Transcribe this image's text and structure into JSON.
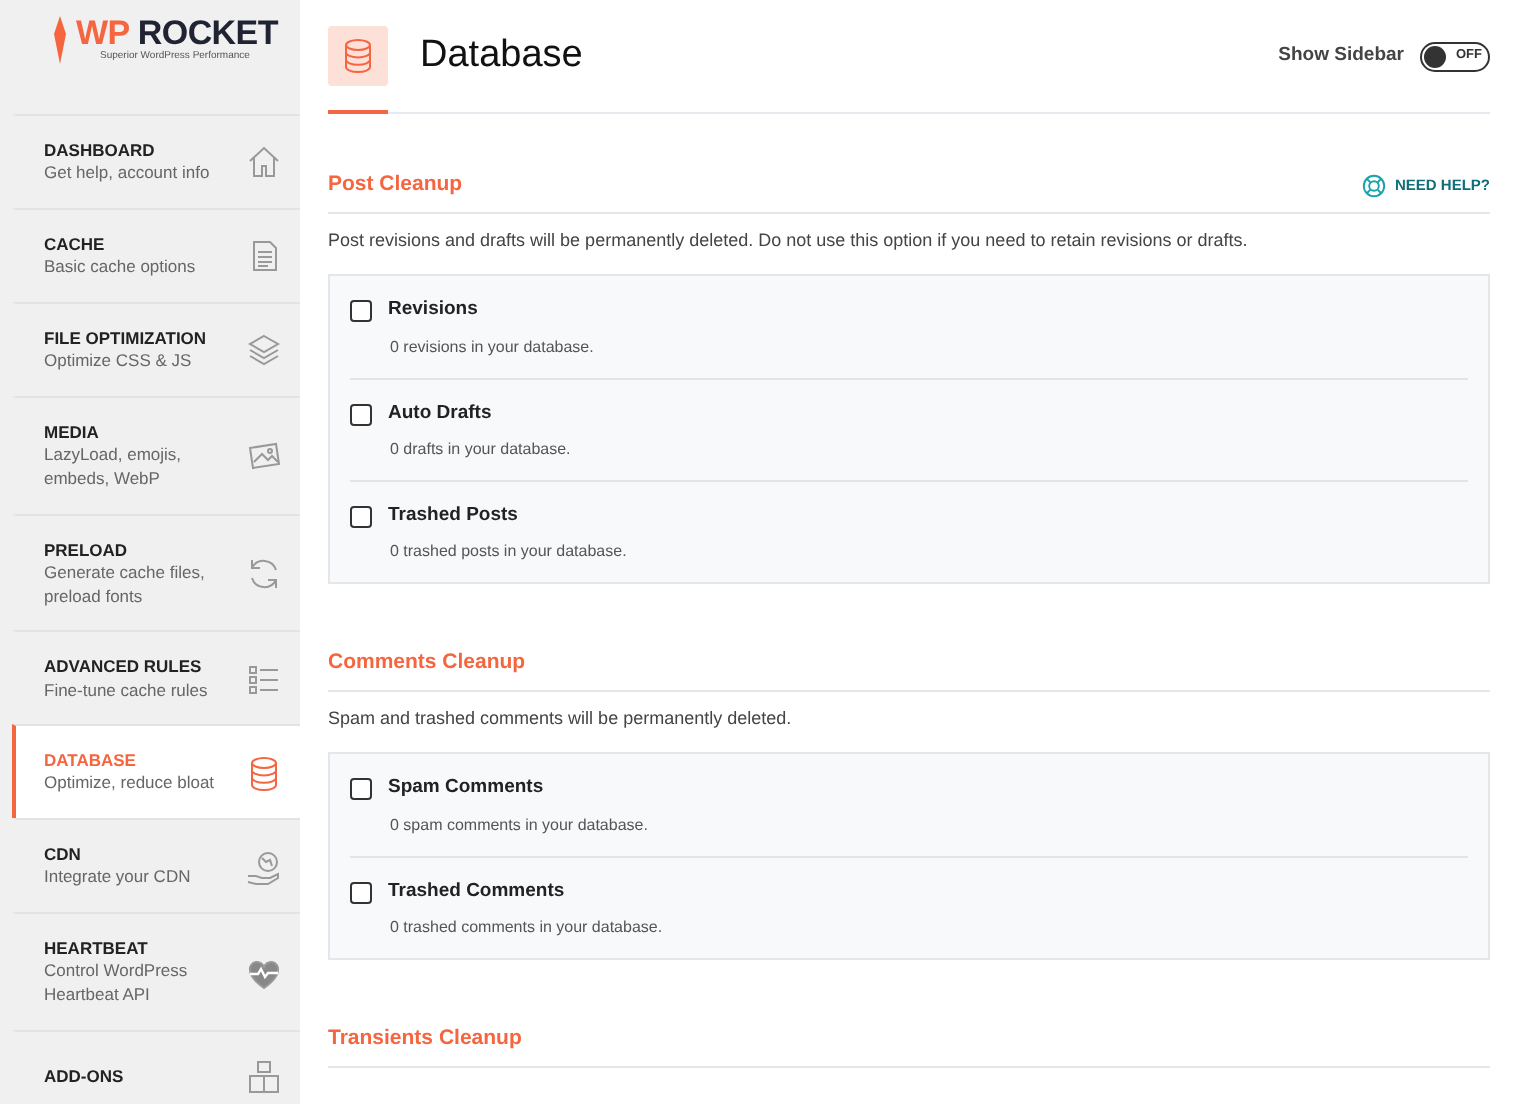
{
  "logo": {
    "brand_first": "WP",
    "brand_second": "ROCKET",
    "tagline": "Superior WordPress Performance"
  },
  "sidebar": {
    "items": [
      {
        "title": "DASHBOARD",
        "subtitle": "Get help, account info",
        "selected": false
      },
      {
        "title": "CACHE",
        "subtitle": "Basic cache options",
        "selected": false
      },
      {
        "title": "FILE OPTIMIZATION",
        "subtitle": "Optimize CSS & JS",
        "selected": false
      },
      {
        "title": "MEDIA",
        "subtitle": "LazyLoad, emojis, embeds, WebP",
        "selected": false
      },
      {
        "title": "PRELOAD",
        "subtitle": "Generate cache files, preload fonts",
        "selected": false
      },
      {
        "title": "ADVANCED RULES",
        "subtitle": "Fine-tune cache rules",
        "selected": false
      },
      {
        "title": "DATABASE",
        "subtitle": "Optimize, reduce bloat",
        "selected": true
      },
      {
        "title": "CDN",
        "subtitle": "Integrate your CDN",
        "selected": false
      },
      {
        "title": "HEARTBEAT",
        "subtitle": "Control WordPress Heartbeat API",
        "selected": false
      },
      {
        "title": "ADD-ONS",
        "selected": false
      }
    ]
  },
  "header": {
    "title": "Database",
    "sidebar_toggle": {
      "label": "Show Sidebar",
      "state_text": "OFF",
      "on": false
    }
  },
  "sections": [
    {
      "title": "Post Cleanup",
      "help_link": "NEED HELP?",
      "description": "Post revisions and drafts will be permanently deleted. Do not use this option if you need to retain revisions or drafts.",
      "options": [
        {
          "label": "Revisions",
          "detail": "0 revisions in your database.",
          "checked": false
        },
        {
          "label": "Auto Drafts",
          "detail": "0 drafts in your database.",
          "checked": false
        },
        {
          "label": "Trashed Posts",
          "detail": "0 trashed posts in your database.",
          "checked": false
        }
      ]
    },
    {
      "title": "Comments Cleanup",
      "description": "Spam and trashed comments will be permanently deleted.",
      "options": [
        {
          "label": "Spam Comments",
          "detail": "0 spam comments in your database.",
          "checked": false
        },
        {
          "label": "Trashed Comments",
          "detail": "0 trashed comments in your database.",
          "checked": false
        }
      ]
    },
    {
      "title": "Transients Cleanup"
    }
  ]
}
